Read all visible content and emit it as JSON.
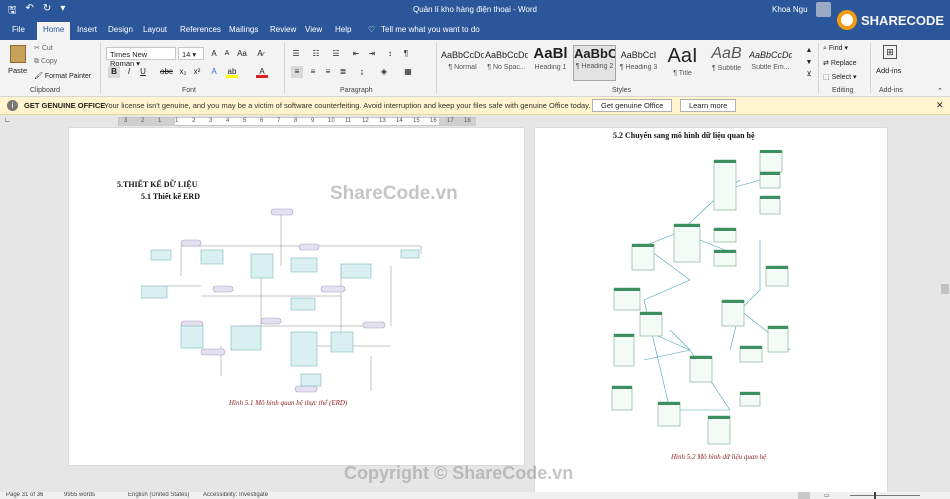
{
  "window": {
    "title": "Quản lí kho hàng điện thoại - Word",
    "user": "Khoa Ngu"
  },
  "tabs": [
    "File",
    "Home",
    "Insert",
    "Design",
    "Layout",
    "References",
    "Mailings",
    "Review",
    "View",
    "Help"
  ],
  "tell_me": "Tell me what you want to do",
  "ribbon": {
    "clipboard": {
      "paste": "Paste",
      "cut": "Cut",
      "copy": "Copy",
      "format_painter": "Format Painter",
      "label": "Clipboard"
    },
    "font": {
      "name": "Times New Roman",
      "size": "14",
      "label": "Font"
    },
    "paragraph": {
      "label": "Paragraph"
    },
    "styles": {
      "label": "Styles",
      "items": [
        {
          "sample": "AaBbCcDd",
          "name": "¶ Normal"
        },
        {
          "sample": "AaBbCcDd",
          "name": "¶ No Spac..."
        },
        {
          "sample": "AaBl",
          "name": "Heading 1"
        },
        {
          "sample": "AaBbC",
          "name": "¶ Heading 2"
        },
        {
          "sample": "AaBbCcI",
          "name": "¶ Heading 3"
        },
        {
          "sample": "AaI",
          "name": "¶ Title"
        },
        {
          "sample": "AaB",
          "name": "¶ Subtitle"
        },
        {
          "sample": "AaBbCcDd",
          "name": "Subtle Em..."
        }
      ]
    },
    "editing": {
      "find": "Find",
      "replace": "Replace",
      "select": "Select",
      "label": "Editing"
    },
    "addins": {
      "button": "Add-ins",
      "label": "Add-ins"
    }
  },
  "message_bar": {
    "heading": "GET GENUINE OFFICE",
    "text": "Your license isn't genuine, and you may be a victim of software counterfeiting. Avoid interruption and keep your files safe with genuine Office today.",
    "get_button": "Get genuine Office",
    "learn_button": "Learn more"
  },
  "ruler": {
    "ticks": [
      "3",
      "2",
      "1",
      "1",
      "2",
      "3",
      "4",
      "5",
      "6",
      "7",
      "8",
      "9",
      "10",
      "11",
      "12",
      "13",
      "14",
      "15",
      "16",
      "17",
      "18"
    ]
  },
  "document": {
    "page1": {
      "heading": "5.THIẾT KẾ DỮ LIỆU",
      "subheading": "5.1 Thiết kế ERD",
      "caption": "Hình 5.1 Mô hình quan hệ thực thể (ERD)"
    },
    "page2": {
      "subheading": "5.2 Chuyển sang mô hình dữ liệu quan hệ",
      "caption": "Hình 5.2 Mô hình dữ liệu quan hệ"
    }
  },
  "watermarks": {
    "center": "ShareCode.vn",
    "bottom": "Copyright © ShareCode.vn",
    "logo": "SHARECODE.vn"
  },
  "status": {
    "page": "Page 31 of 36",
    "words": "9955 words",
    "language": "English (United States)",
    "accessibility": "Accessibility: Investigate"
  },
  "colors": {
    "word_blue": "#2b579a",
    "message_bg": "#fff4ce",
    "caption_red": "#8b1e1e"
  }
}
